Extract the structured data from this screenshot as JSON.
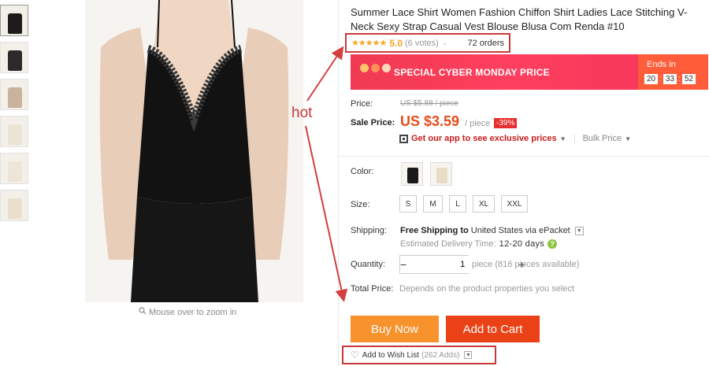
{
  "product": {
    "title": "Summer Lace Shirt Women Fashion Chiffon Shirt Ladies Lace Stitching V-Neck Sexy Strap Casual Vest Blouse Blusa Com Renda #10",
    "stars": "★★★★★",
    "rating": "5.0",
    "votes": "(6 votes)",
    "orders": "72 orders",
    "zoom_hint": "Mouse over to zoom in"
  },
  "annotation": {
    "label": "hot",
    "color": "#c9393c"
  },
  "promo": {
    "banner_text": "SPECIAL CYBER MONDAY PRICE",
    "ends_label": "Ends in",
    "timer": [
      "20",
      "33",
      "52"
    ]
  },
  "price": {
    "label": "Price:",
    "original": "US $5.88 / piece",
    "sale_label": "Sale Price:",
    "sale": "US $3.59",
    "unit": "/ piece",
    "discount": "-39%",
    "app_text": "Get our app to see exclusive prices",
    "bulk_price": "Bulk Price"
  },
  "options": {
    "color_label": "Color:",
    "colors": [
      {
        "name": "black",
        "hex": "#1a1a1a"
      },
      {
        "name": "beige",
        "hex": "#e8dcc7"
      }
    ],
    "size_label": "Size:",
    "sizes": [
      "S",
      "M",
      "L",
      "XL",
      "XXL"
    ],
    "shipping_label": "Shipping:",
    "shipping_text": "Free Shipping to",
    "shipping_dest": "United States via ePacket",
    "delivery_label": "Estimated Delivery Time:",
    "delivery_days": "12-20 days",
    "quantity_label": "Quantity:",
    "quantity": "1",
    "quantity_note": "piece (816 pieces available)",
    "total_label": "Total Price:",
    "total_note": "Depends on the product properties you select"
  },
  "actions": {
    "buy_now": "Buy Now",
    "add_to_cart": "Add to Cart",
    "wishlist": "Add to Wish List",
    "wishlist_count": "(262 Adds)"
  },
  "colors": {
    "accent_orange": "#f7922d",
    "cart_red": "#ea4216",
    "price_red": "#e74c1c",
    "banner_pink": "#f03a52"
  }
}
